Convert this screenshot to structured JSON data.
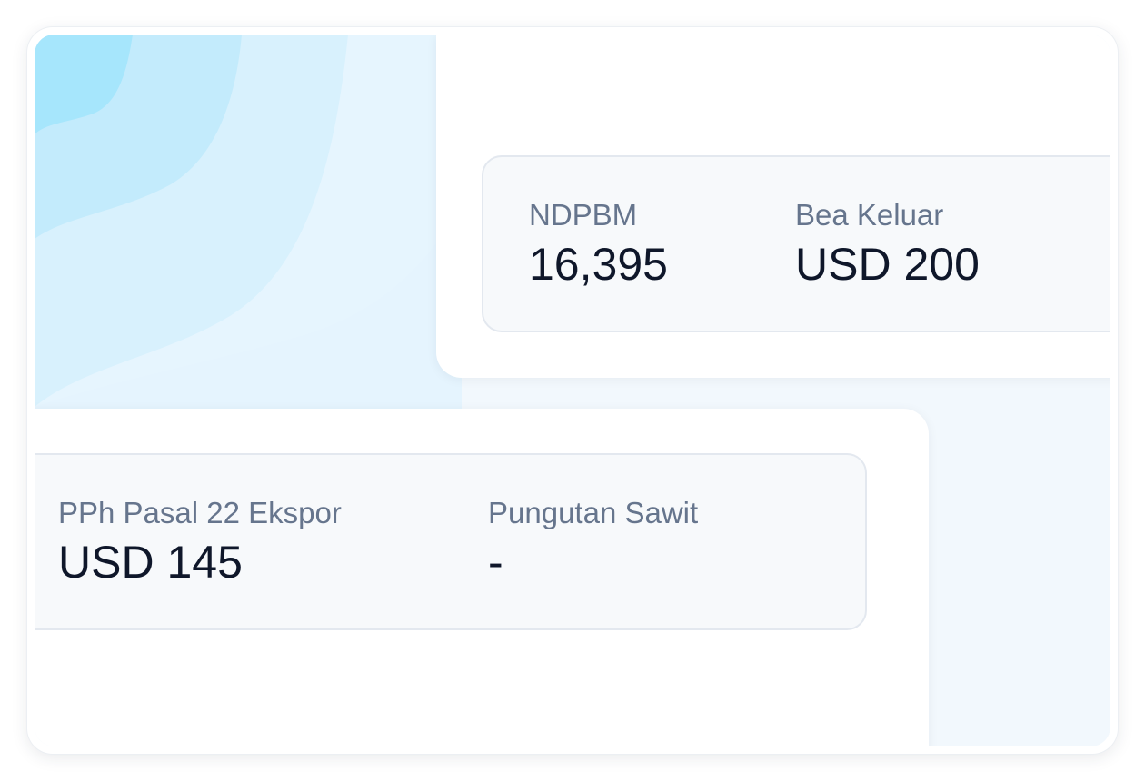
{
  "colors": {
    "label": "#66758d",
    "value": "#0f172a",
    "panel_background": "#f7f9fb",
    "panel_border": "#e3e8ef",
    "wave_dark": "#a6e6fc",
    "wave_light": "#e4f4fd"
  },
  "top_card": {
    "stats": [
      {
        "label": "NDPBM",
        "value": "16,395"
      },
      {
        "label": "Bea Keluar",
        "value": "USD 200"
      }
    ]
  },
  "bottom_card": {
    "stats": [
      {
        "label": "PPh Pasal 22 Ekspor",
        "value": "USD 145"
      },
      {
        "label": "Pungutan Sawit",
        "value": "-"
      }
    ]
  }
}
